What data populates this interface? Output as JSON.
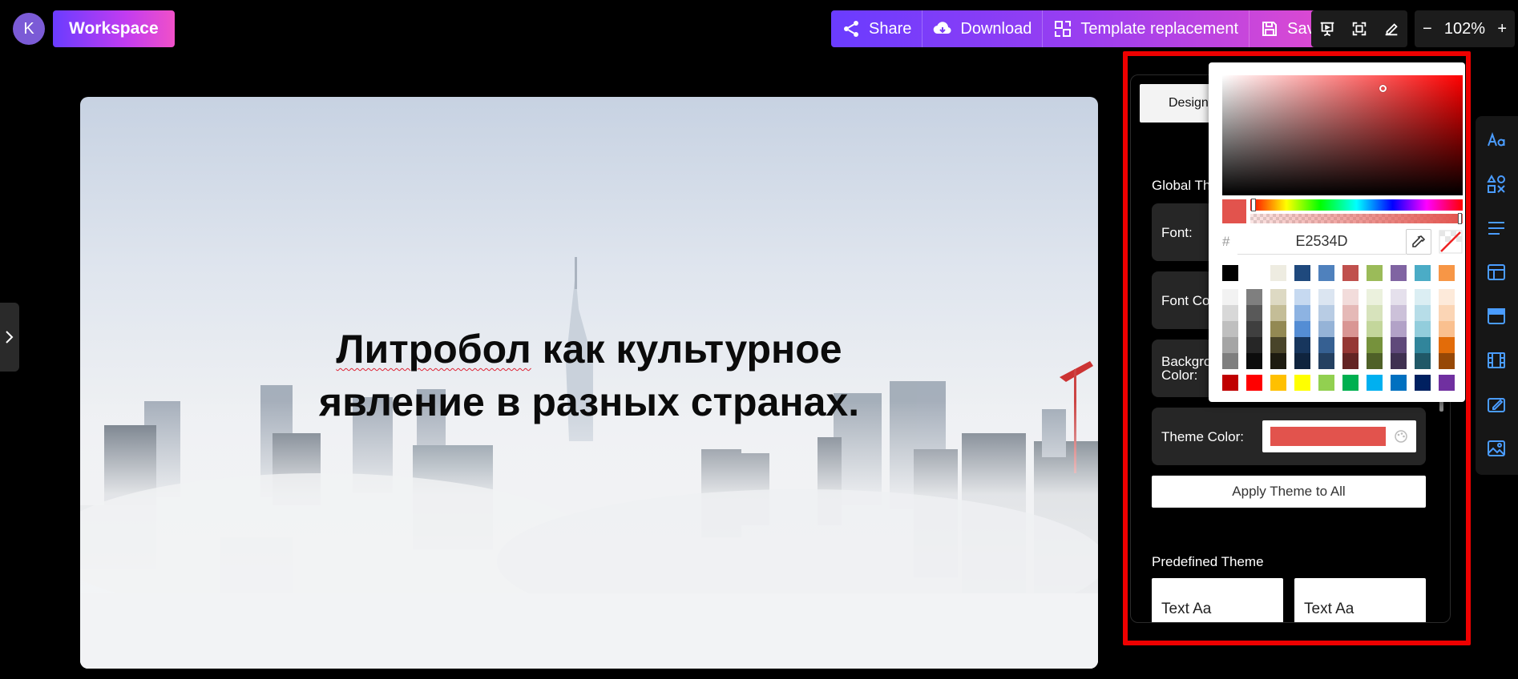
{
  "header": {
    "avatar_initial": "K",
    "workspace_label": "Workspace",
    "actions": {
      "share": "Share",
      "download": "Download",
      "template_replacement": "Template replacement",
      "save": "Save"
    },
    "zoom": {
      "minus": "−",
      "level": "102%",
      "plus": "+"
    }
  },
  "slide": {
    "title_word1": "Литробол",
    "title_rest_line1": " как культурное",
    "title_line2": "явление в разных странах."
  },
  "design_panel": {
    "tab_label": "Design",
    "global_theme_label": "Global Th",
    "rows": {
      "font": "Font:",
      "font_color": "Font Co",
      "background_color_line1": "Backgro",
      "background_color_line2": "Color:",
      "theme_color": "Theme Color:"
    },
    "theme_color_value": "#E2534D",
    "apply_label": "Apply Theme to All",
    "predefined_label": "Predefined Theme",
    "theme_samples": [
      "Text Aa",
      "Text Aa"
    ]
  },
  "color_picker": {
    "hash": "#",
    "hex_value": "E2534D",
    "current_color": "#E2534D",
    "swatch_rows": [
      [
        "#000000",
        "#ffffff",
        "#eeece1",
        "#1f497d",
        "#4f81bd",
        "#c0504d",
        "#9bbb59",
        "#8064a2",
        "#4bacc6",
        "#f79646"
      ],
      [
        "#f2f2f2",
        "#7f7f7f",
        "#ddd9c3",
        "#c6d9f0",
        "#dbe5f1",
        "#f2dcdb",
        "#ebf1dd",
        "#e5e0ec",
        "#dbeef3",
        "#fdeada"
      ],
      [
        "#d8d8d8",
        "#595959",
        "#c4bd97",
        "#8db3e2",
        "#b8cce4",
        "#e5b9b7",
        "#d7e3bc",
        "#ccc1d9",
        "#b7dde8",
        "#fbd5b5"
      ],
      [
        "#bfbfbf",
        "#3f3f3f",
        "#938953",
        "#548dd4",
        "#95b3d7",
        "#d99694",
        "#c3d69b",
        "#b2a2c7",
        "#92cddc",
        "#fac08f"
      ],
      [
        "#a5a5a5",
        "#262626",
        "#494429",
        "#17365d",
        "#366092",
        "#953734",
        "#76923c",
        "#5f497a",
        "#31859b",
        "#e36c09"
      ],
      [
        "#7f7f7f",
        "#0c0c0c",
        "#1d1b10",
        "#0f243e",
        "#244061",
        "#632423",
        "#4f6128",
        "#3f3151",
        "#205867",
        "#974806"
      ],
      [
        "#c00000",
        "#ff0000",
        "#ffc000",
        "#ffff00",
        "#92d050",
        "#00b050",
        "#00b0f0",
        "#0070c0",
        "#002060",
        "#7030a0"
      ]
    ]
  },
  "colors": {
    "accent_start": "#6a3cff",
    "accent_end": "#f050c8",
    "highlight_outline": "#ee0000",
    "rail_icon": "#4a9cff"
  },
  "icons": {
    "share": "share-icon",
    "download": "cloud-download-icon",
    "template": "template-icon",
    "save": "floppy-icon",
    "present": "presentation-icon",
    "fullscreen": "fullscreen-icon",
    "edit": "pencil-icon"
  }
}
